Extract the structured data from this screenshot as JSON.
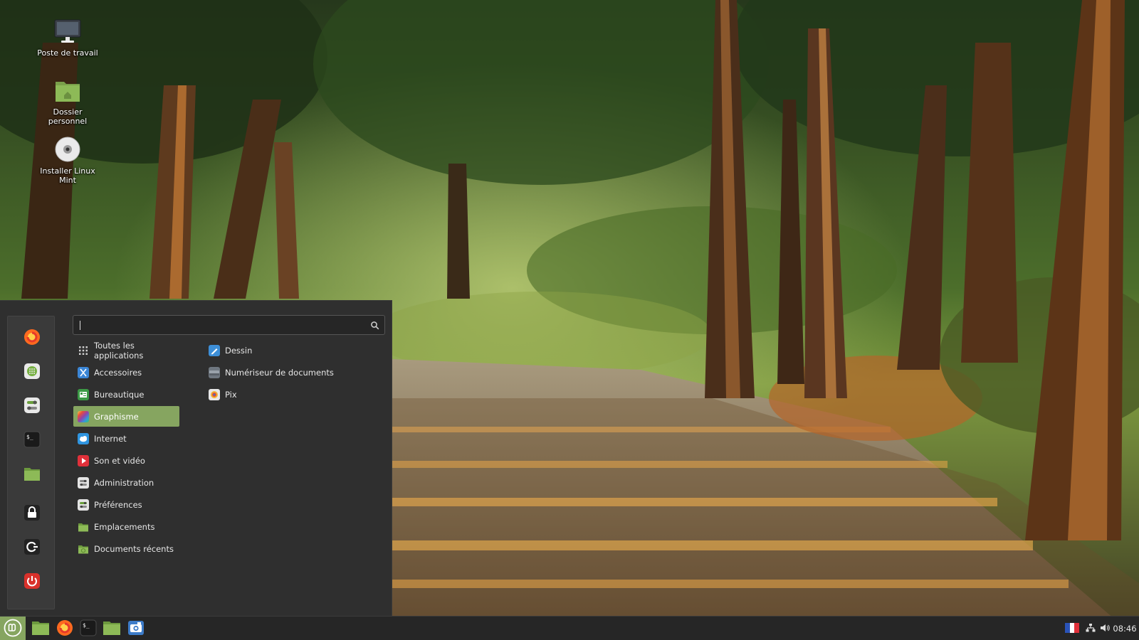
{
  "desktop": {
    "icons": [
      {
        "label": "Poste de travail",
        "icon": "computer-icon"
      },
      {
        "label": "Dossier personnel",
        "icon": "home-folder-icon"
      },
      {
        "label": "Installer Linux Mint",
        "icon": "disc-icon"
      }
    ]
  },
  "menu": {
    "search": {
      "value": "",
      "placeholder": ""
    },
    "favorites": [
      {
        "name": "firefox",
        "icon": "firefox-icon"
      },
      {
        "name": "software-manager",
        "icon": "software-manager-icon"
      },
      {
        "name": "settings",
        "icon": "settings-icon"
      },
      {
        "name": "terminal",
        "icon": "terminal-icon"
      },
      {
        "name": "files",
        "icon": "folder-icon"
      },
      {
        "name": "lock-screen",
        "icon": "lock-icon"
      },
      {
        "name": "logout",
        "icon": "logout-icon"
      },
      {
        "name": "shutdown",
        "icon": "power-icon"
      }
    ],
    "categories": [
      {
        "label": "Toutes les applications",
        "icon": "grid-icon"
      },
      {
        "label": "Accessoires",
        "icon": "accessories-icon"
      },
      {
        "label": "Bureautique",
        "icon": "office-icon"
      },
      {
        "label": "Graphisme",
        "icon": "graphics-icon",
        "active": true
      },
      {
        "label": "Internet",
        "icon": "internet-icon"
      },
      {
        "label": "Son et vidéo",
        "icon": "media-icon"
      },
      {
        "label": "Administration",
        "icon": "administration-icon"
      },
      {
        "label": "Préférences",
        "icon": "preferences-icon"
      },
      {
        "label": "Emplacements",
        "icon": "places-folder-icon"
      },
      {
        "label": "Documents récents",
        "icon": "recent-folder-icon"
      }
    ],
    "apps": [
      {
        "label": "Dessin",
        "icon": "drawing-icon"
      },
      {
        "label": "Numériseur de documents",
        "icon": "scanner-icon"
      },
      {
        "label": "Pix",
        "icon": "pix-icon"
      }
    ]
  },
  "panel": {
    "launchers": [
      {
        "name": "menu",
        "icon": "mint-logo-icon"
      },
      {
        "name": "show-desktop",
        "icon": "desktop-icon"
      },
      {
        "name": "firefox",
        "icon": "firefox-icon"
      },
      {
        "name": "terminal",
        "icon": "terminal-icon"
      },
      {
        "name": "files",
        "icon": "folder-icon"
      },
      {
        "name": "screenshot",
        "icon": "camera-icon"
      }
    ],
    "tray": {
      "keyboard_layout": "fr",
      "clock": "08:46"
    }
  },
  "colors": {
    "accent": "#86a560",
    "menu_bg": "#2f2f2f",
    "panel_bg": "#262626"
  }
}
